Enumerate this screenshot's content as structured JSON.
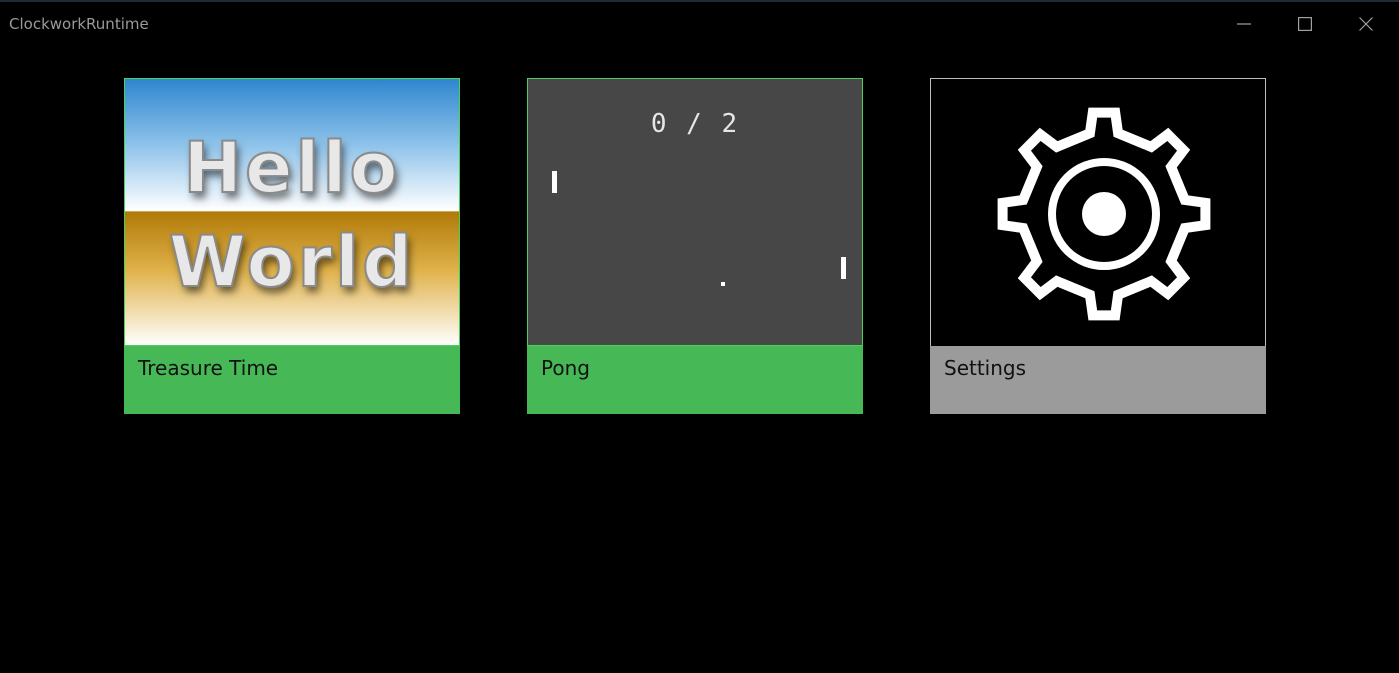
{
  "window": {
    "title": "ClockworkRuntime",
    "caption_buttons": [
      {
        "name": "minimize",
        "icon": "minimize-icon"
      },
      {
        "name": "maximize",
        "icon": "maximize-icon"
      },
      {
        "name": "close",
        "icon": "close-icon"
      }
    ]
  },
  "tiles": [
    {
      "label": "Treasure Time",
      "image_text": [
        "Hello",
        "World"
      ],
      "label_bar_color": "#46b856",
      "border_color": "#4bd25a"
    },
    {
      "label": "Pong",
      "score": "0 / 2",
      "label_bar_color": "#46b856",
      "border_color": "#4bd25a"
    },
    {
      "label": "Settings",
      "icon": "gear-icon",
      "label_bar_color": "#9b9b9b"
    }
  ]
}
